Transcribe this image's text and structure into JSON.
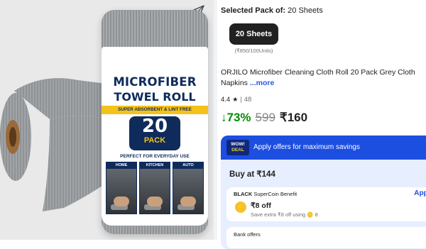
{
  "product_image": {
    "label": {
      "line1": "MICROFIBER",
      "line2": "TOWEL ROLL",
      "strip": "SUPER ABSORBENT & LINT FREE",
      "pack_number": "20",
      "pack_word": "PACK",
      "usage": "PERFECT FOR EVERYDAY USE",
      "tiles": [
        "HOME",
        "KITCHEN",
        "AUTO"
      ]
    }
  },
  "variant": {
    "selected_label": "Selected Pack of:",
    "selected_value": "20 Sheets",
    "chip_label": "20 Sheets",
    "chip_sub": "(₹850/100Units)"
  },
  "product": {
    "title": "ORJILO Microfiber Cleaning Cloth Roll 20 Pack Grey Cloth Napkins",
    "more_link": "...more",
    "rating": "4.4",
    "rating_count": "48"
  },
  "price": {
    "discount": "↓73%",
    "mrp": "599",
    "selling": "₹160"
  },
  "offers": {
    "badge_line1": "WOW!",
    "badge_line2": "DEAL",
    "header": "Apply offers for maximum savings",
    "buy_at": "Buy at ₹144",
    "supercoin_brand": "BLACK",
    "supercoin_label": "SuperCoin Benefit",
    "apply": "Apply",
    "coin_glyph": "⚡",
    "supercoin_off": "₹8 off",
    "supercoin_save": "Save extra ₹8 off using 🪙 8",
    "bank_offers": "Bank offers"
  },
  "colors": {
    "accent_blue": "#1c4ee0",
    "discount_green": "#008c00",
    "brand_navy": "#0e2b5c"
  }
}
